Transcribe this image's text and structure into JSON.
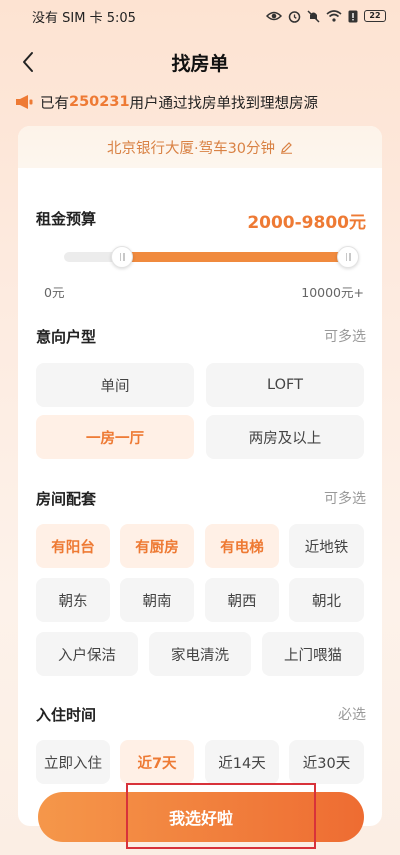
{
  "status_bar": {
    "carrier_time": "没有 SIM 卡 5:05",
    "battery": "22"
  },
  "header": {
    "title": "找房单"
  },
  "notice": {
    "prefix": "已有",
    "count": "250231",
    "suffix": "用户通过找房单找到理想房源"
  },
  "card": {
    "location": "北京银行大厦·驾车30分钟",
    "budget": {
      "title": "租金预算",
      "range": "2000-9800元",
      "min_label": "0元",
      "max_label": "10000元+",
      "min_value": 2000,
      "max_value": 9800,
      "scale_max": 10000
    },
    "layout": {
      "title": "意向户型",
      "hint": "可多选",
      "options": [
        "单间",
        "LOFT",
        "一房一厅",
        "两房及以上"
      ]
    },
    "amenities": {
      "title": "房间配套",
      "hint": "可多选",
      "options": [
        "有阳台",
        "有厨房",
        "有电梯",
        "近地铁",
        "朝东",
        "朝南",
        "朝西",
        "朝北",
        "入户保洁",
        "家电清洗",
        "上门喂猫"
      ]
    },
    "move_in": {
      "title": "入住时间",
      "hint": "必选",
      "options": [
        "立即入住",
        "近7天",
        "近14天",
        "近30天"
      ]
    }
  },
  "submit": {
    "label": "我选好啦"
  },
  "colors": {
    "accent": "#ee7a34",
    "selected_bg": "#fff0e6",
    "highlight": "#d8323a"
  }
}
